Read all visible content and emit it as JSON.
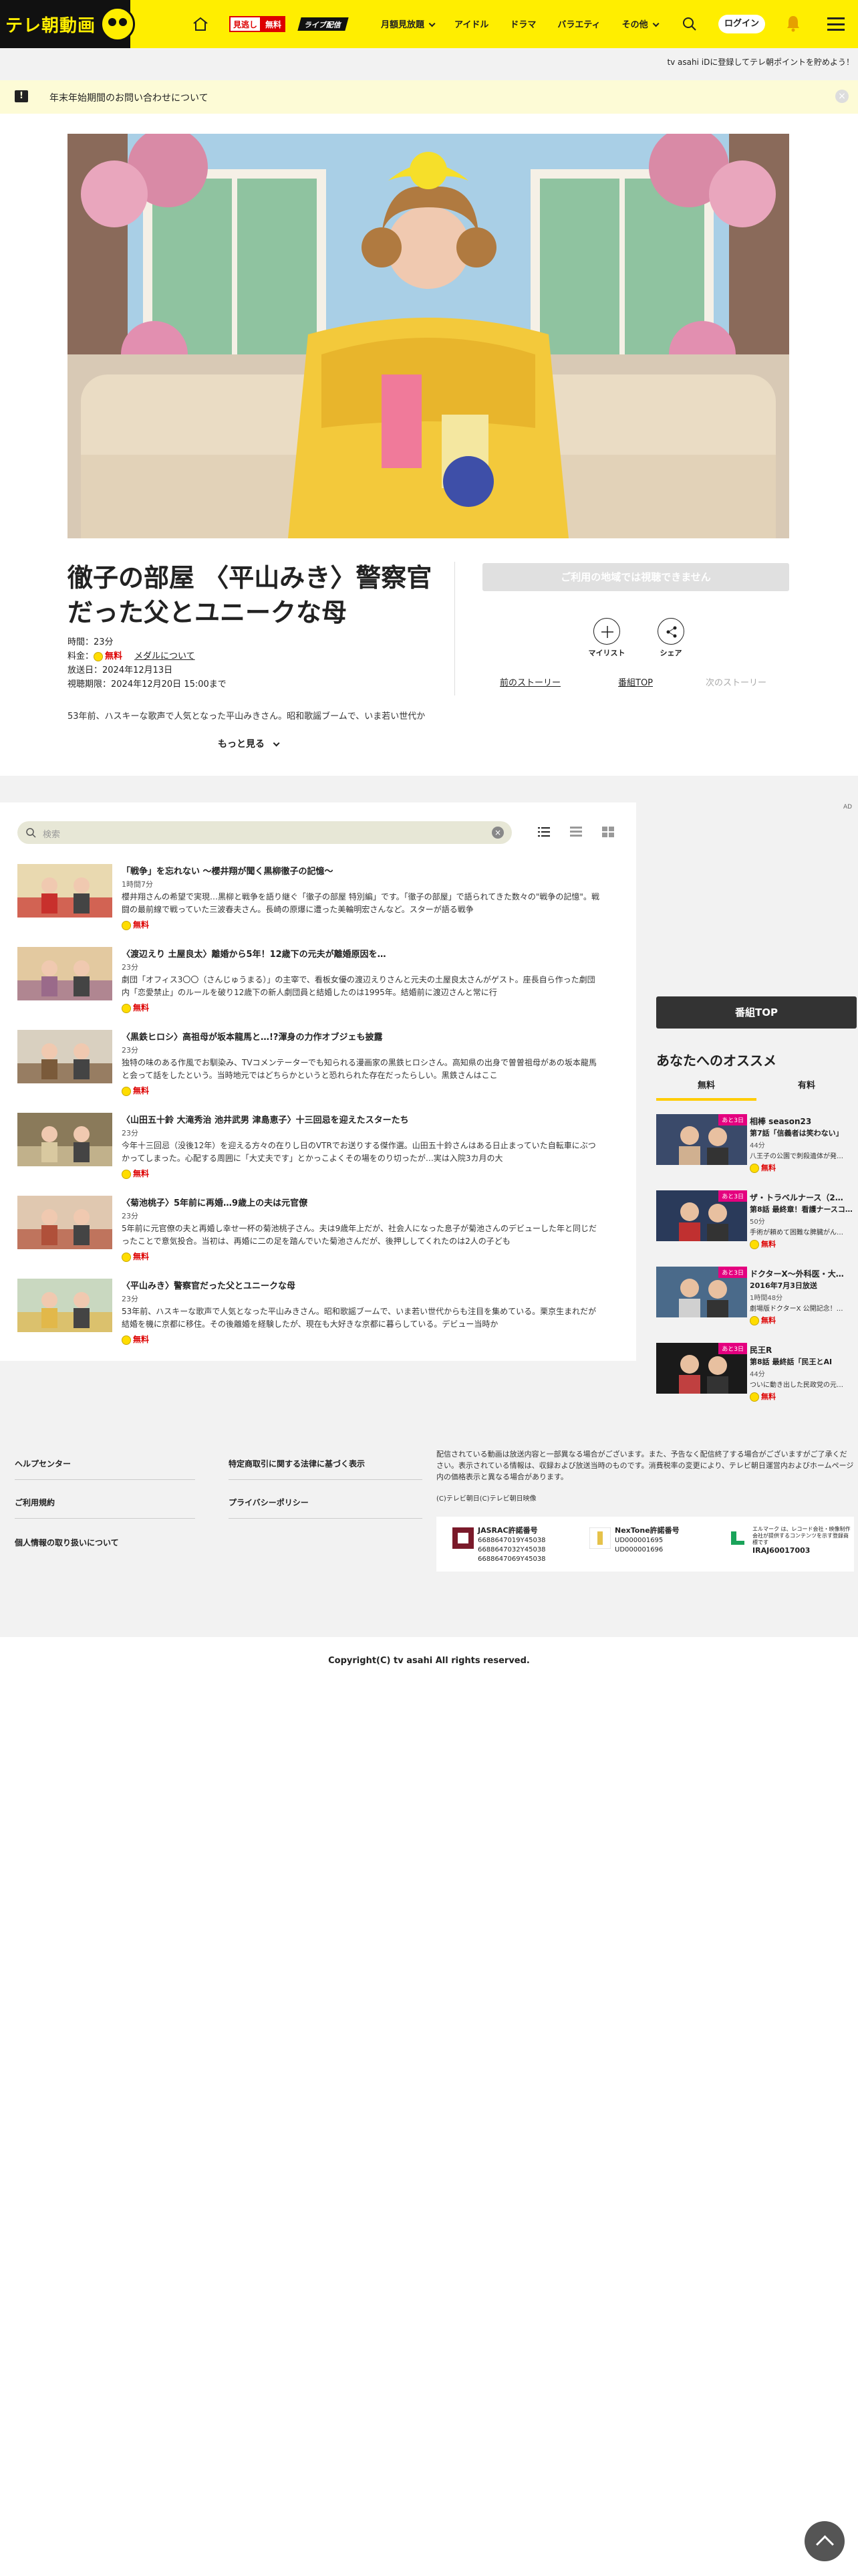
{
  "header": {
    "logo_text": "テレ朝動画",
    "mitoshi_a": "見逃し",
    "mitoshi_b": "無料",
    "live": "ライブ配信",
    "nav": [
      "月額見放題",
      "アイドル",
      "ドラマ",
      "バラエティ",
      "その他"
    ],
    "login": "ログイン"
  },
  "promo": "tv asahi iDに登録してテレ朝ポイントを貯めよう！",
  "notice": {
    "icon": "!",
    "text": "年末年始期間のお問い合わせについて"
  },
  "program": {
    "title": "徹子の部屋 〈平山みき〉警察官だった父とユニークな母",
    "time_label": "時間：",
    "time": "23分",
    "fee_label": "料金：",
    "fee": "無料",
    "medal_link": "メダルについて",
    "aired_label": "放送日：",
    "aired": "2024年12月13日",
    "period_label": "視聴期限：",
    "period": "2024年12月20日 15:00まで",
    "desc": "53年前、ハスキーな歌声で人気となった平山みきさん。昭和歌謡ブームで、いま若い世代か",
    "more": "もっと見る",
    "unavailable": "ご利用の地域では視聴できません",
    "mylist": "マイリスト",
    "share": "シェア",
    "prev": "前のストーリー",
    "top": "番組TOP",
    "next": "次のストーリー"
  },
  "list": {
    "placeholder": "検索",
    "free": "無料",
    "episodes": [
      {
        "title": "「戦争」を忘れない ～櫻井翔が聞く黒柳徹子の記憶～",
        "dur": "1時間7分",
        "desc": "櫻井翔さんの希望で実現…黒柳と戦争を語り継ぐ「徹子の部屋 特別編」です。「徹子の部屋」で語られてきた数々の\"戦争の記憶\"。戦闘の最前線で戦っていた三波春夫さん。長崎の原爆に遭った美輪明宏さんなど。スターが語る戦争"
      },
      {
        "title": "〈渡辺えり 土屋良太〉離婚から5年！12歳下の元夫が離婚原因を…",
        "dur": "23分",
        "desc": "劇団「オフィス3〇〇（さんじゅうまる）」の主宰で、看板女優の渡辺えりさんと元夫の土屋良太さんがゲスト。座長自ら作った劇団内「恋愛禁止」のルールを破り12歳下の新人劇団員と結婚したのは1995年。結婚前に渡辺さんと常に行"
      },
      {
        "title": "〈黒鉄ヒロシ〉高祖母が坂本龍馬と…!?渾身の力作オブジェも披露",
        "dur": "23分",
        "desc": "独特の味のある作風でお馴染み、TVコメンテーターでも知られる漫画家の黒鉄ヒロシさん。高知県の出身で曽曽祖母があの坂本龍馬と会って話をしたという。当時地元ではどちらかというと恐れられた存在だったらしい。黒鉄さんはここ"
      },
      {
        "title": "〈山田五十鈴 大滝秀治 池井武男 津島恵子〉十三回忌を迎えたスターたち",
        "dur": "23分",
        "desc": "今年十三回忌（没後12年）を迎える方々の在りし日のVTRでお送りする傑作選。山田五十鈴さんはある日止まっていた自転車にぶつかってしまった。心配する周囲に「大丈夫です」とかっこよくその場をのり切ったが…実は入院3カ月の大"
      },
      {
        "title": "〈菊池桃子〉5年前に再婚…9歳上の夫は元官僚",
        "dur": "23分",
        "desc": "5年前に元官僚の夫と再婚し幸せ一杯の菊池桃子さん。夫は9歳年上だが、社会人になった息子が菊池さんのデビューした年と同じだったことで意気投合。当初は、再婚に二の足を踏んでいた菊池さんだが、後押ししてくれたのは2人の子ども"
      },
      {
        "title": "〈平山みき〉警察官だった父とユニークな母",
        "dur": "23分",
        "desc": "53年前、ハスキーな歌声で人気となった平山みきさん。昭和歌謡ブームで、いま若い世代からも注目を集めている。栗京生まれだが結婚を機に京都に移住。その後離婚を経験したが、現在も大好きな京都に暮らしている。デビュー当時か"
      }
    ]
  },
  "sidebar": {
    "top_button": "番組TOP",
    "heading": "あなたへのオススメ",
    "tab_free": "無料",
    "tab_paid": "有料",
    "tag": "あと3日",
    "free": "無料",
    "recs": [
      {
        "title": "相棒 season23",
        "sub": "第7話「信義者は笑わない」",
        "dur": "44分",
        "desc": "八王子の公園で刺殺遺体が発…"
      },
      {
        "title": "ザ・トラベルナース（2…",
        "sub": "第8話 最終章！看護ナースコ…",
        "dur": "50分",
        "desc": "手術が頼めて困難な脾臓がん…"
      },
      {
        "title": "ドクターX～外科医・大…",
        "sub": "2016年7月3日放送",
        "dur": "1時間48分",
        "desc": "劇場版ドクターX 公開記念！…"
      },
      {
        "title": "民王R",
        "sub": "第8話 最終話「民王とAI",
        "dur": "44分",
        "desc": "ついに動き出した民政党の元…"
      }
    ]
  },
  "footer": {
    "links_col1": [
      "ヘルプセンター",
      "ご利用規約",
      "個人情報の取り扱いについて"
    ],
    "links_col2": [
      "特定商取引に関する法律に基づく表示",
      "プライバシーポリシー"
    ],
    "note": "配信されている動画は放送内容と一部異なる場合がございます。また、予告なく配信終了する場合がございますがご了承ください。表示されている情報は、収録および放送当時のものです。消費税率の変更により、テレビ朝日運営内およびホームページ内の価格表示と異なる場合があります。",
    "copy_small": "(C)テレビ朝日(C)テレビ朝日映像",
    "lic1_title": "JASRAC許諾番号",
    "lic1_lines": [
      "6688647019Y45038",
      "6688647032Y45038",
      "6688647069Y45038"
    ],
    "lic2_title": "NexTone許諾番号",
    "lic2_lines": [
      "UD000001695",
      "UD000001696"
    ],
    "lic3_lines": [
      "エルマーク は、レコード会社・映像制作",
      "会社が提供するコンテンツを示す登録商",
      "標です"
    ],
    "lic3_code": "IRAJ60017003",
    "copyright": "Copyright(C) tv asahi All rights reserved."
  },
  "colors": {
    "brand_yellow": "#ffee00",
    "free_red": "#dd0000",
    "tag_pink": "#e4007f"
  }
}
